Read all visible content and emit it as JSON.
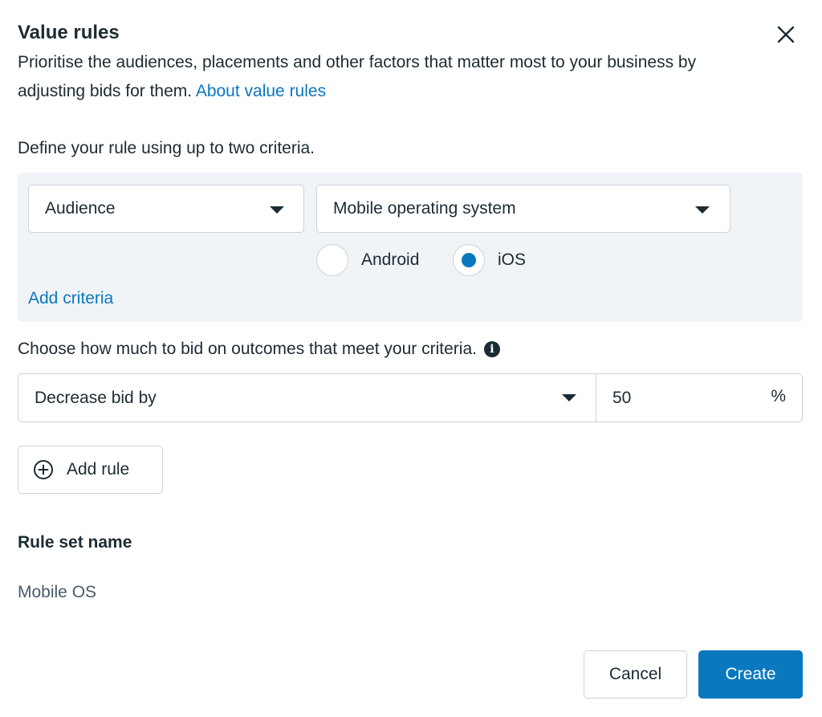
{
  "dialog": {
    "title": "Value rules",
    "description": "Prioritise the audiences, placements and other factors that matter most to your business by adjusting bids for them.",
    "about_link": "About value rules",
    "close_icon": "close-icon"
  },
  "criteria": {
    "label": "Define your rule using up to two criteria.",
    "primary_select": {
      "value": "Audience",
      "icon": "caret-down-icon"
    },
    "secondary_select": {
      "value": "Mobile operating system",
      "icon": "caret-down-icon"
    },
    "options": [
      {
        "label": "Android",
        "selected": false
      },
      {
        "label": "iOS",
        "selected": true
      }
    ],
    "add_criteria_link": "Add criteria",
    "accent_color": "#0a78be"
  },
  "bid": {
    "label": "Choose how much to bid on outcomes that meet your criteria.",
    "info_icon": "info-icon",
    "action_select": "Decrease bid by",
    "amount": "50",
    "unit": "%"
  },
  "add_rule": {
    "label": "Add rule",
    "icon": "plus-circle-icon"
  },
  "rule_set": {
    "title": "Rule set name",
    "value": "Mobile OS"
  },
  "footer": {
    "cancel_label": "Cancel",
    "create_label": "Create",
    "create_color": "#0a78be"
  }
}
